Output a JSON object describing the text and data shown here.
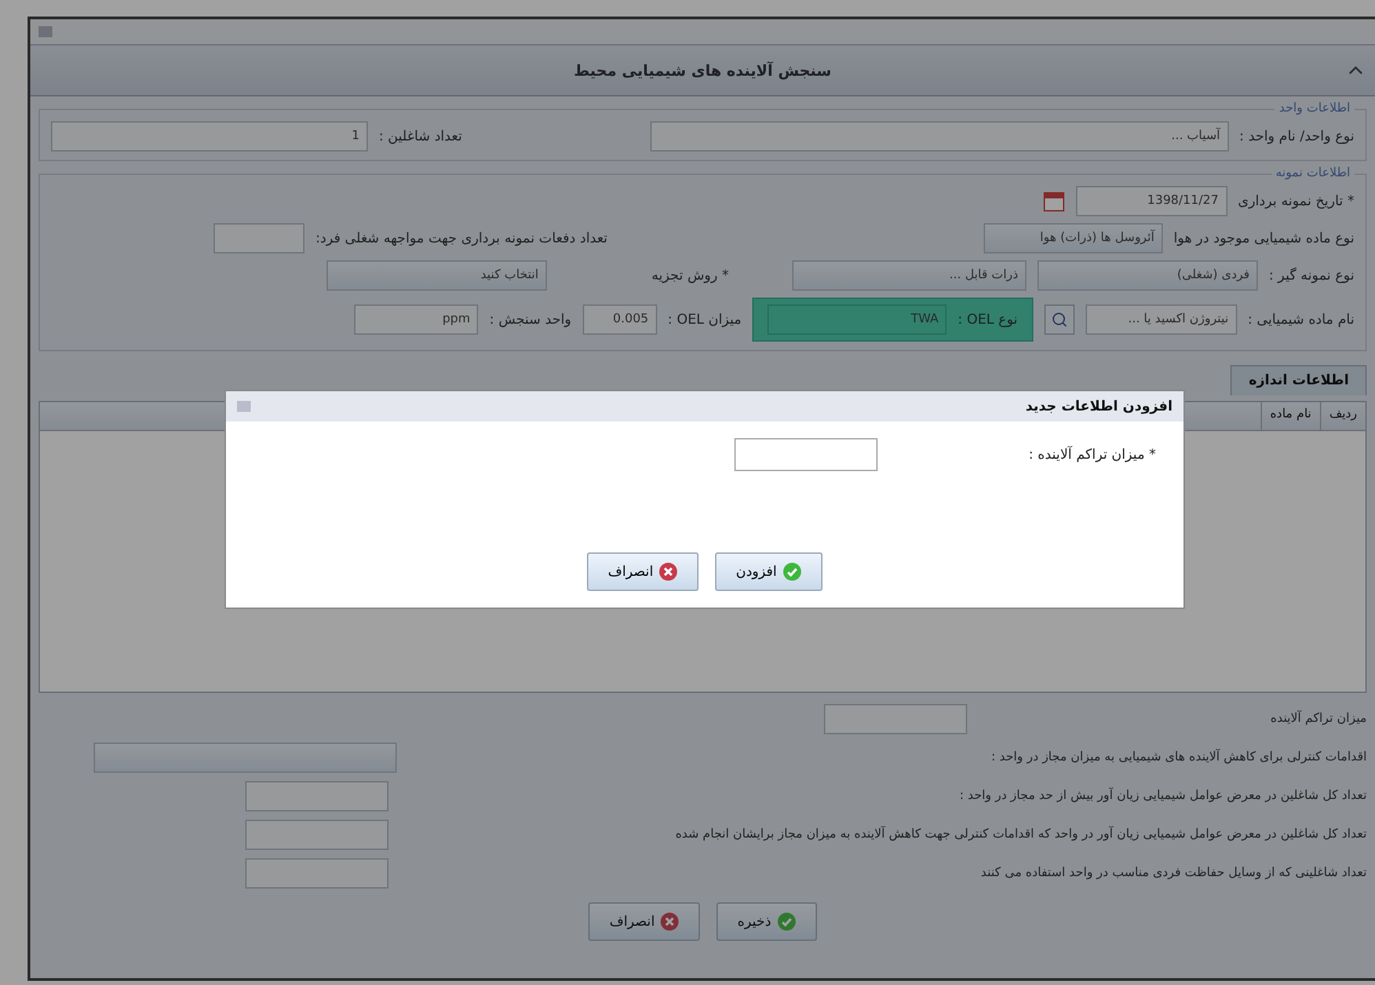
{
  "window": {
    "title": "سنجش آلاینده های شیمیایی محیط"
  },
  "unit_section": {
    "legend": "اطلاعات واحد",
    "unit_label": "نوع واحد/ نام واحد :",
    "unit_value": "آسیاب ...",
    "workers_label": "تعداد شاغلین :",
    "workers_value": "1"
  },
  "sample_section": {
    "legend": "اطلاعات نمونه",
    "date_label": "* تاریخ نمونه برداری",
    "date_value": "1398/11/27",
    "substance_type_label": "نوع ماده شیمیایی موجود در هوا",
    "substance_type_value": "آئروسل ها (ذرات) هوا",
    "count_label": "تعداد دفعات نمونه برداری جهت مواجهه شغلی فرد:",
    "sampler_label": "نوع نمونه گیر :",
    "sampler_value": "فردی (شغلی)",
    "particle_value": "ذرات قابل ...",
    "method_label": "* روش تجزیه",
    "method_value": "انتخاب کنید",
    "name_label": "نام ماده شیمیایی :",
    "name_value": "نیتروژن اکسید یا ...",
    "oel_type_label": "نوع OEL :",
    "oel_type_value": "TWA",
    "oel_level_label": "میزان OEL :",
    "oel_level_value": "0.005",
    "unit_label": "واحد سنجش :",
    "unit_value": "ppm"
  },
  "tabs": [
    {
      "label": "اطلاعات اندازه",
      "selected": true
    }
  ],
  "table": {
    "columns": [
      "ردیف",
      "نام ماده"
    ]
  },
  "bottom_rows": [
    {
      "label": "میزان تراکم آلاینده",
      "kind": "input"
    },
    {
      "label": "اقدامات کنترلی برای کاهش آلاینده های شیمیایی به میزان مجاز در واحد :",
      "kind": "select"
    },
    {
      "label": "تعداد کل شاغلین در معرض عوامل شیمیایی زیان آور بیش از حد مجاز در واحد :",
      "kind": "input"
    },
    {
      "label": "تعداد کل شاغلین در معرض عوامل شیمیایی زیان آور در واحد که اقدامات کنترلی جهت کاهش آلاینده به میزان مجاز برایشان انجام شده",
      "kind": "input"
    },
    {
      "label": "تعداد شاغلینی که از وسایل حفاظت فردی مناسب در واحد استفاده می کنند",
      "kind": "input"
    }
  ],
  "buttons": [
    {
      "label": "ذخیره",
      "kind": "ok"
    },
    {
      "label": "انصراف",
      "kind": "cancel"
    }
  ],
  "dialog": {
    "title": "افزودن اطلاعات جدید",
    "field_label": "* میزان تراکم آلاینده :",
    "buttons": [
      {
        "label": "افزودن",
        "kind": "ok"
      },
      {
        "label": "انصراف",
        "kind": "cancel"
      }
    ]
  }
}
